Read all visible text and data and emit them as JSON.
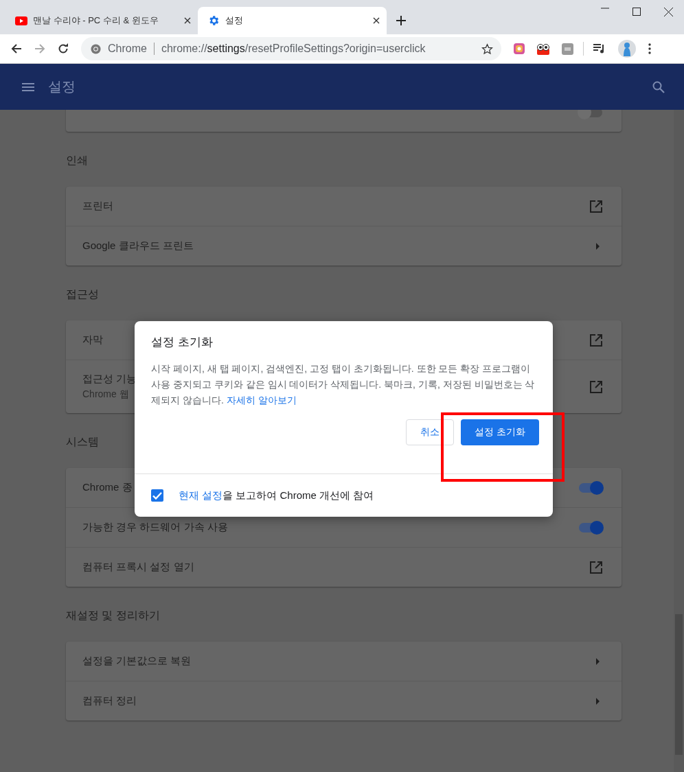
{
  "tabs": [
    {
      "title": "맨날 수리야 - PC 수리 & 윈도우",
      "kind": "video",
      "selected": false
    },
    {
      "title": "설정",
      "kind": "settings",
      "selected": true
    }
  ],
  "address_bar": {
    "label": "Chrome",
    "url_scheme": "chrome://",
    "url_host": "settings",
    "url_path": "/resetProfileSettings?origin=userclick"
  },
  "header": {
    "title": "설정"
  },
  "sections": [
    {
      "rows": [
        {
          "kind": "toggle",
          "on": false
        }
      ]
    },
    {
      "heading": "인쇄",
      "rows": [
        {
          "label": "프린터",
          "kind": "external"
        },
        {
          "label": "Google 클라우드 프린트",
          "kind": "arrow"
        }
      ]
    },
    {
      "heading": "접근성",
      "rows": [
        {
          "label": "자막",
          "kind": "external"
        },
        {
          "label": "접근성 기능",
          "sublabel": "Chrome 웹",
          "kind": "external"
        }
      ]
    },
    {
      "heading": "시스템",
      "rows": [
        {
          "label": "Chrome 종",
          "kind": "toggle",
          "on": true
        },
        {
          "label": "가능한 경우 하드웨어 가속 사용",
          "kind": "toggle",
          "on": true
        },
        {
          "label": "컴퓨터 프록시 설정 열기",
          "kind": "external"
        }
      ]
    },
    {
      "heading": "재설정 및 정리하기",
      "rows": [
        {
          "label": "설정을 기본값으로 복원",
          "kind": "arrow"
        },
        {
          "label": "컴퓨터 정리",
          "kind": "arrow"
        }
      ]
    }
  ],
  "dialog": {
    "title": "설정 초기화",
    "body": "시작 페이지, 새 탭 페이지, 검색엔진, 고정 탭이 초기화됩니다. 또한 모든 확장 프로그램이 사용 중지되고 쿠키와 같은 임시 데이터가 삭제됩니다. 북마크, 기록, 저장된 비밀번호는 삭제되지 않습니다.",
    "link": "자세히 알아보기",
    "cancel_button": "취소",
    "confirm_button": "설정 초기화",
    "report": {
      "checked": true,
      "link": "현재 설정",
      "text": "을 보고하여 Chrome 개선에 참여"
    }
  }
}
